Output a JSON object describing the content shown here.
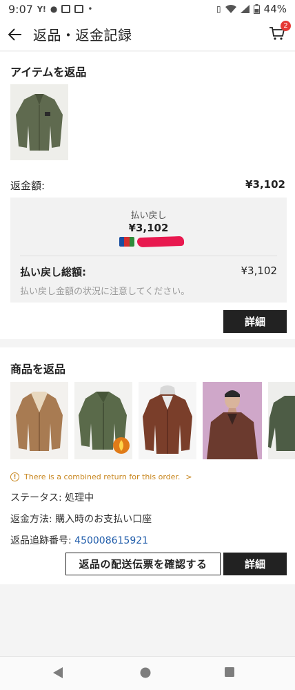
{
  "status_bar": {
    "time": "9:07",
    "battery": "44%"
  },
  "header": {
    "title": "返品・返金記録",
    "cart_badge": "2"
  },
  "section1": {
    "title": "アイテムを返品",
    "refund_label": "返金額:",
    "refund_value": "¥3,102",
    "box": {
      "label": "払い戻し",
      "amount": "¥3,102",
      "total_label": "払い戻し総額:",
      "total_value": "¥3,102",
      "note": "払い戻し金額の状況に注意してください。"
    },
    "details_button": "詳細"
  },
  "section2": {
    "title": "商品を返品",
    "notice": "There is a combined return for this order.",
    "status_line": "ステータス: 処理中",
    "method_line": "返金方法: 購入時のお支払い口座",
    "tracking_label": "返品追跡番号: ",
    "tracking_number": "450008615921",
    "confirm_button": "返品の配送伝票を確認する",
    "details_button": "詳細"
  },
  "icons": {
    "back": "arrow-left-icon",
    "cart": "cart-icon",
    "info": "info-circle-icon",
    "nav": [
      "back-triangle-icon",
      "home-circle-icon",
      "recents-square-icon"
    ]
  },
  "colors": {
    "accent_red": "#e53935",
    "notice": "#c8861e",
    "link": "#1d5aa9",
    "button_dark": "#222222"
  }
}
